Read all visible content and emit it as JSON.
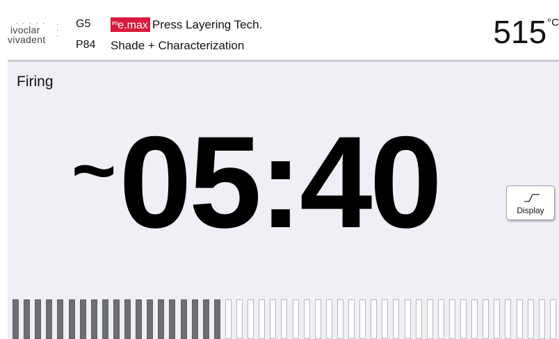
{
  "header": {
    "logo": {
      "line1": "ivoclar",
      "line2": "vivadent"
    },
    "group_code": "G5",
    "program_code": "P84",
    "brand_badge": "e.max",
    "brand_badge_prefix": "IPS",
    "program_title": "Press Layering Tech.",
    "program_subtitle": "Shade + Characterization",
    "temperature": {
      "value": "515",
      "unit": "°C"
    }
  },
  "status": {
    "label": "Firing"
  },
  "timer": {
    "approx_symbol": "~",
    "remaining": "05:40"
  },
  "buttons": {
    "display_label": "Display"
  },
  "progress": {
    "total_segments": 49,
    "filled_segments": 19
  },
  "colors": {
    "brand_accent": "#d81b3a",
    "progress_filled": "#6d6f75",
    "screen_background": "#eef0f5"
  },
  "icons": {
    "display_button": "firing-curve-icon"
  }
}
